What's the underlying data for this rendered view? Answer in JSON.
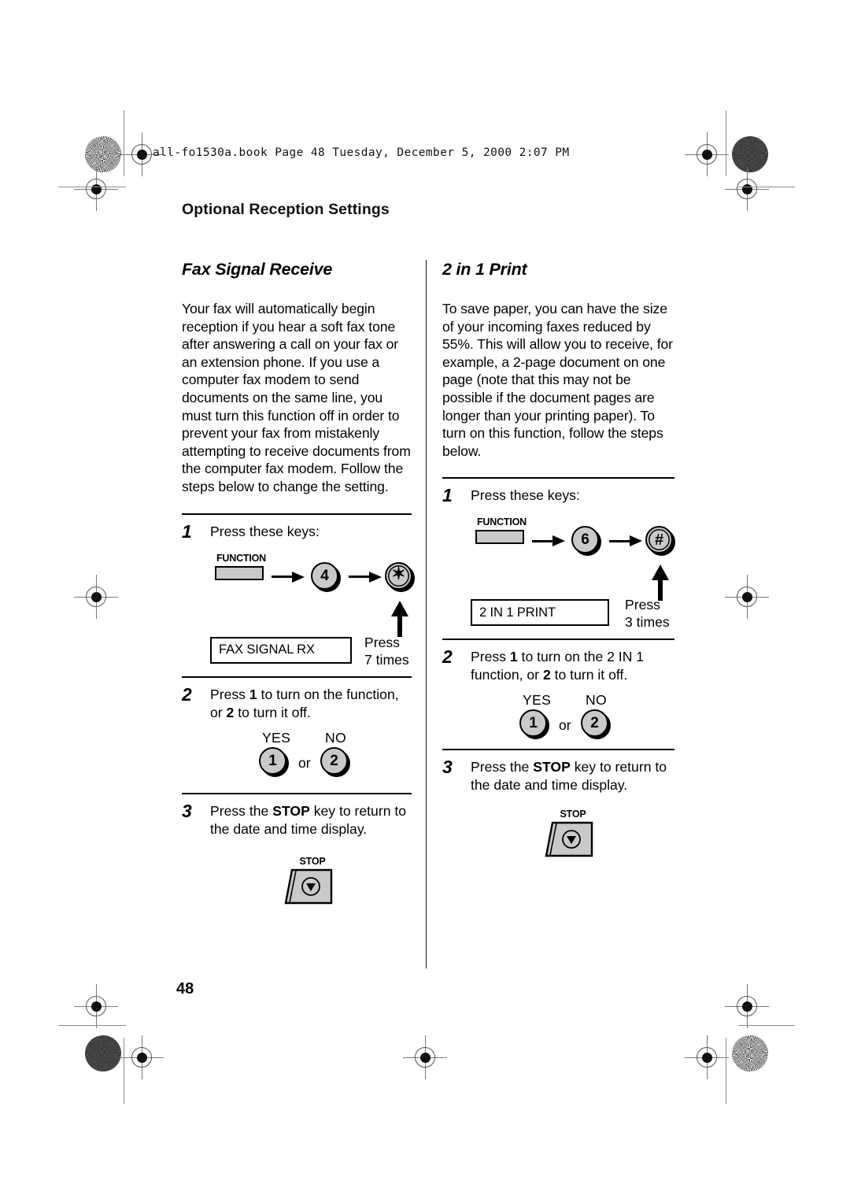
{
  "file_header": "all-fo1530a.book  Page 48  Tuesday, December 5, 2000  2:07 PM",
  "running_head": "Optional Reception Settings",
  "page_number": "48",
  "colors": {
    "key_fill": "#c9c9c9",
    "ink": "#000000",
    "reg_mark": "#777777"
  },
  "left_column": {
    "title": "Fax Signal Receive",
    "intro": "Your fax will automatically begin reception if you hear a soft fax tone after answering a call on your fax or an extension phone. If you use a computer fax modem to send documents on the same line, you must turn this function off in order to prevent your fax from mistakenly attempting to receive documents from the computer fax modem. Follow the steps below to change the setting.",
    "steps": [
      {
        "number": "1",
        "text": "Press these keys:",
        "function_key_label": "FUNCTION",
        "key_1": "4",
        "key_2": "✶",
        "key_2_name": "asterisk-key",
        "lcd": "FAX SIGNAL RX",
        "press_line_1": "Press",
        "press_line_2": "7 times"
      },
      {
        "number": "2",
        "text_parts": [
          "Press ",
          "1",
          " to turn on the function, or ",
          "2",
          " to turn it off."
        ],
        "yes_label": "YES",
        "no_label": "NO",
        "yes_key": "1",
        "no_key": "2",
        "or_label": "or"
      },
      {
        "number": "3",
        "text_parts": [
          "Press the ",
          "STOP",
          " key to return to the date and time display."
        ],
        "stop_key_label": "STOP"
      }
    ]
  },
  "right_column": {
    "title": "2 in 1 Print",
    "intro": "To save paper, you can have the size of your incoming faxes reduced by 55%. This will allow you to receive, for example, a 2-page document on one page (note that this may not be possible if the document pages are longer than your printing paper). To turn on this function, follow the steps below.",
    "steps": [
      {
        "number": "1",
        "text": "Press these keys:",
        "function_key_label": "FUNCTION",
        "key_1": "6",
        "key_2": "#",
        "key_2_name": "hash-key",
        "lcd": "2 IN 1 PRINT",
        "press_line_1": "Press",
        "press_line_2": "3 times"
      },
      {
        "number": "2",
        "text_parts": [
          "Press ",
          "1",
          " to turn on the 2 IN 1 function, or ",
          "2",
          " to turn it off."
        ],
        "yes_label": "YES",
        "no_label": "NO",
        "yes_key": "1",
        "no_key": "2",
        "or_label": "or"
      },
      {
        "number": "3",
        "text_parts": [
          "Press the ",
          "STOP",
          " key to return to the date and time display."
        ],
        "stop_key_label": "STOP"
      }
    ]
  }
}
